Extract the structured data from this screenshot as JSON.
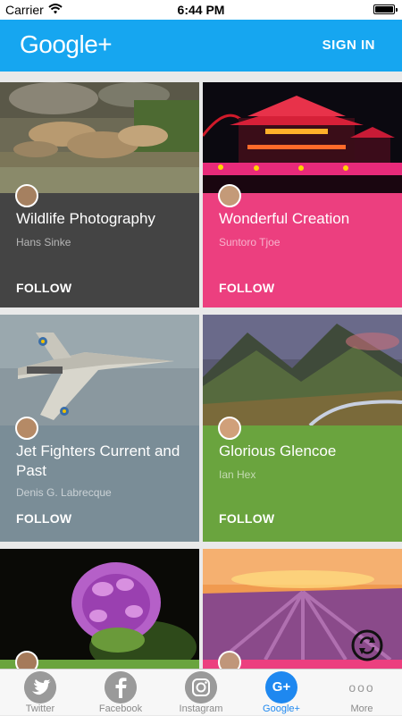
{
  "status_bar": {
    "carrier": "Carrier",
    "time": "6:44 PM"
  },
  "app_bar": {
    "title": "Google+",
    "sign_in": "SIGN IN"
  },
  "colors": {
    "app_bar": "#16a6f0",
    "card_dark": "#444444",
    "card_pink": "#ec3f7f",
    "card_slate": "#7a8d97",
    "card_green": "#6aa43e",
    "tab_active": "#1e88f0"
  },
  "cards": [
    {
      "title": "Wildlife Photography",
      "author": "Hans Sinke",
      "follow": "FOLLOW"
    },
    {
      "title": "Wonderful Creation",
      "author": "Suntoro Tjoe",
      "follow": "FOLLOW"
    },
    {
      "title": "Jet Fighters Current and Past",
      "author": "Denis G. Labrecque",
      "follow": "FOLLOW"
    },
    {
      "title": "Glorious Glencoe",
      "author": "Ian Hex",
      "follow": "FOLLOW"
    }
  ],
  "tabs": [
    {
      "label": "Twitter",
      "icon": "twitter-icon"
    },
    {
      "label": "Facebook",
      "icon": "facebook-icon"
    },
    {
      "label": "Instagram",
      "icon": "instagram-icon"
    },
    {
      "label": "Google+",
      "icon": "google-plus-icon",
      "glyph": "G+"
    },
    {
      "label": "More",
      "icon": "more-icon",
      "glyph": "ooo"
    }
  ]
}
